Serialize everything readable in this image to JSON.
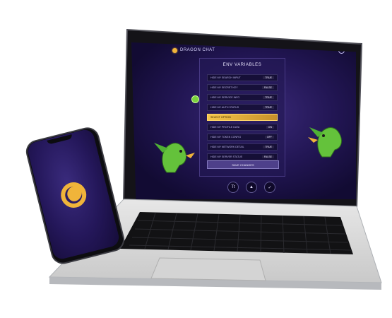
{
  "laptop_ui": {
    "brand": "DRAGON CHAT",
    "panel_title": "ENV VARIABLES",
    "rows": [
      {
        "label": "HIDE MY SEARCH INPUT",
        "value": "TRUE",
        "selected": false
      },
      {
        "label": "HIDE MY SECRET KEY",
        "value": "FALSE",
        "selected": false
      },
      {
        "label": "HIDE MY SERVICE INFO",
        "value": "TRUE",
        "selected": false
      },
      {
        "label": "HIDE MY AUTH STATUS",
        "value": "TRUE",
        "selected": false
      },
      {
        "label": "SELECT OPTION",
        "value": "",
        "selected": true
      },
      {
        "label": "HIDE MY PROFILE DATA",
        "value": "ON",
        "selected": false
      },
      {
        "label": "HIDE MY TOKEN CONFIG",
        "value": "OFF",
        "selected": false
      },
      {
        "label": "HIDE MY NETWORK DETAIL",
        "value": "TRUE",
        "selected": false
      },
      {
        "label": "HIDE MY SERVER STATUS",
        "value": "FALSE",
        "selected": false
      }
    ],
    "panel_button": "SAVE CHANGES",
    "bottom_icons": [
      "text-size-icon",
      "send-icon",
      "check-icon"
    ],
    "bottom_labels": [
      "Tt",
      "▲",
      "✓"
    ]
  },
  "colors": {
    "accent_gold": "#f0b43a",
    "ui_purple": "#2a1c63",
    "dragon_green": "#6cc13a"
  }
}
